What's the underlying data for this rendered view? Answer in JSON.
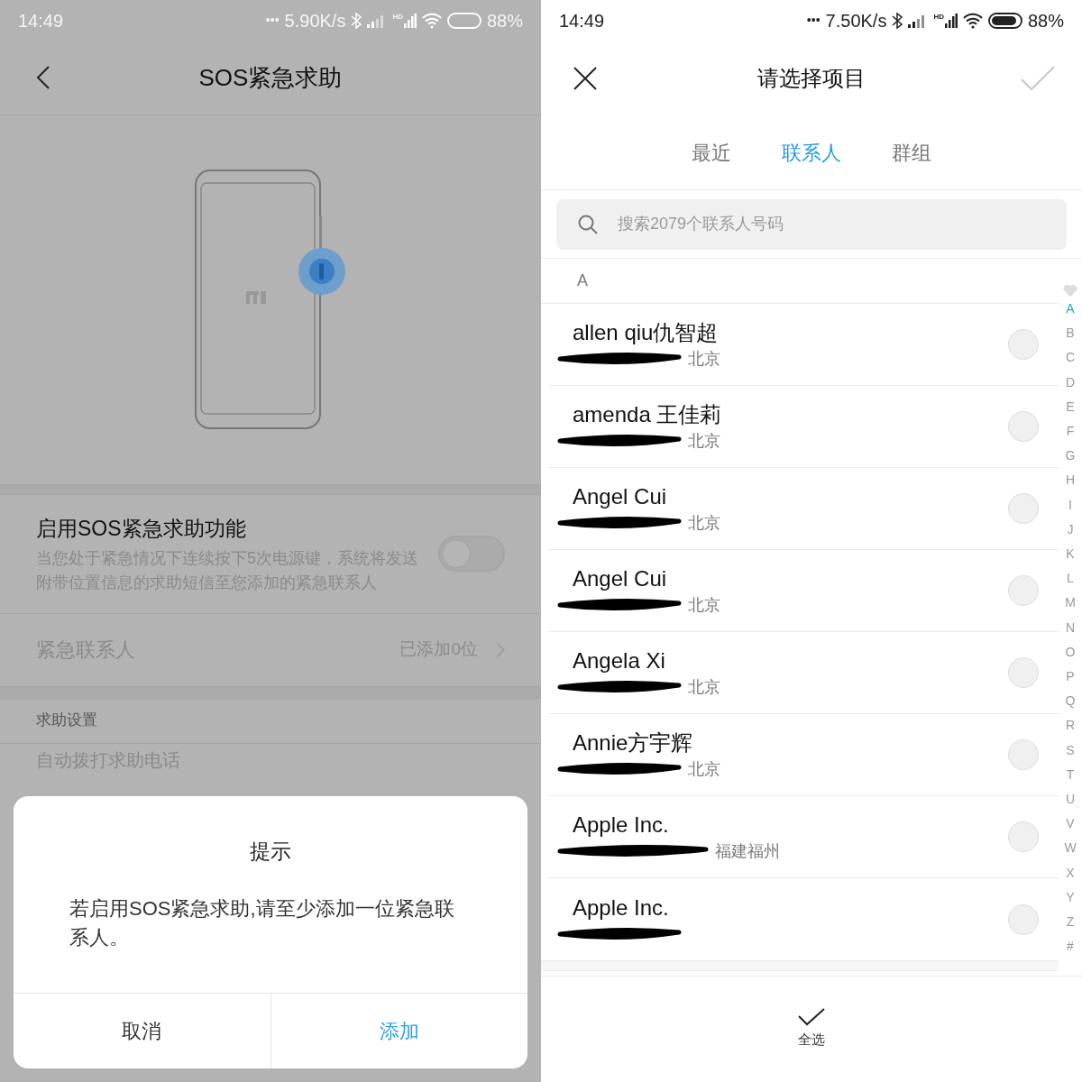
{
  "left_screen": {
    "status_bar": {
      "time": "14:49",
      "dots": "•••",
      "speed": "5.90K/s",
      "hd": "HD",
      "battery": "88%"
    },
    "header": {
      "title": "SOS紧急求助"
    },
    "enable_setting": {
      "title": "启用SOS紧急求助功能",
      "description": "当您处于紧急情况下连续按下5次电源键，系统将发送附带位置信息的求助短信至您添加的紧急联系人",
      "on": false
    },
    "emergency_contacts": {
      "label": "紧急联系人",
      "value": "已添加0位"
    },
    "help_settings": {
      "header": "求助设置",
      "item": "自动拨打求助电话"
    },
    "dialog": {
      "title": "提示",
      "message": "若启用SOS紧急求助,请至少添加一位紧急联系人。",
      "buttons": [
        {
          "label": "取消",
          "kind": "cancel"
        },
        {
          "label": "添加",
          "kind": "primary"
        }
      ]
    }
  },
  "right_screen": {
    "status_bar": {
      "time": "14:49",
      "dots": "•••",
      "speed": "7.50K/s",
      "hd": "HD",
      "battery": "88%"
    },
    "header": {
      "title": "请选择项目",
      "confirm_disabled": true
    },
    "tabs": [
      {
        "label": "最近",
        "selected": false
      },
      {
        "label": "联系人",
        "selected": true
      },
      {
        "label": "群组",
        "selected": false
      }
    ],
    "search": {
      "placeholder": "搜索2079个联系人号码"
    },
    "section": "A",
    "contacts": [
      {
        "name": "allen qiu仇智超",
        "detail": "北京",
        "selected": false
      },
      {
        "name": "amenda 王佳莉",
        "detail": "北京",
        "selected": false
      },
      {
        "name": "Angel Cui",
        "detail": "北京",
        "selected": false
      },
      {
        "name": "Angel Cui",
        "detail": "北京",
        "selected": false
      },
      {
        "name": "Angela Xi",
        "detail": "北京",
        "selected": false
      },
      {
        "name": "Annie方宇辉",
        "detail": "北京",
        "selected": false
      },
      {
        "name": "Apple Inc.",
        "detail": "福建福州",
        "selected": false
      },
      {
        "name": "Apple Inc.",
        "selected": false
      }
    ],
    "index": [
      {
        "label": "A",
        "selected": true
      },
      {
        "label": "B",
        "selected": false
      },
      {
        "label": "C",
        "selected": false
      },
      {
        "label": "D",
        "selected": false
      },
      {
        "label": "E",
        "selected": false
      },
      {
        "label": "F",
        "selected": false
      },
      {
        "label": "G",
        "selected": false
      },
      {
        "label": "H",
        "selected": false
      },
      {
        "label": "I",
        "selected": false
      },
      {
        "label": "J",
        "selected": false
      },
      {
        "label": "K",
        "selected": false
      },
      {
        "label": "L",
        "selected": false
      },
      {
        "label": "M",
        "selected": false
      },
      {
        "label": "N",
        "selected": false
      },
      {
        "label": "O",
        "selected": false
      },
      {
        "label": "P",
        "selected": false
      },
      {
        "label": "Q",
        "selected": false
      },
      {
        "label": "R",
        "selected": false
      },
      {
        "label": "S",
        "selected": false
      },
      {
        "label": "T",
        "selected": false
      },
      {
        "label": "U",
        "selected": false
      },
      {
        "label": "V",
        "selected": false
      },
      {
        "label": "W",
        "selected": false
      },
      {
        "label": "X",
        "selected": false
      },
      {
        "label": "Y",
        "selected": false
      },
      {
        "label": "Z",
        "selected": false
      },
      {
        "label": "#",
        "selected": false
      }
    ],
    "bottom_action": {
      "label": "全选"
    }
  }
}
